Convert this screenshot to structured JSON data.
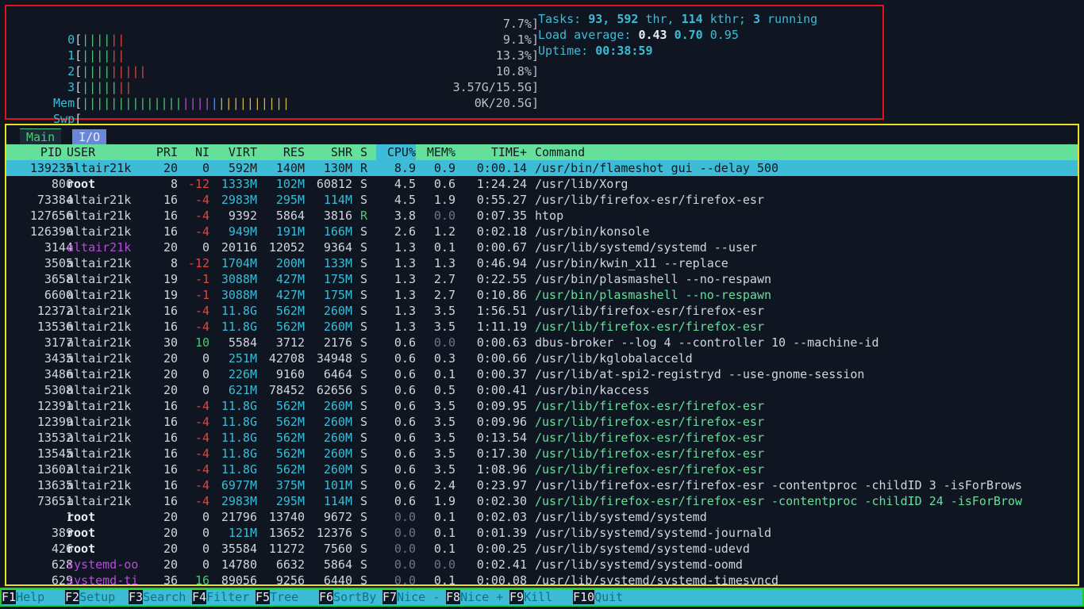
{
  "meters": {
    "cpus": [
      {
        "label": "0",
        "value": "7.7%]"
      },
      {
        "label": "1",
        "value": "9.1%]"
      },
      {
        "label": "2",
        "value": "13.3%]"
      },
      {
        "label": "3",
        "value": "10.8%]"
      }
    ],
    "mem": {
      "label": "Mem",
      "value": "3.57G/15.5G]"
    },
    "swp": {
      "label": "Swp",
      "value": "0K/20.5G]"
    }
  },
  "stats": {
    "tasks_label": "Tasks:",
    "tasks": "93,",
    "threads": "592",
    "thr_label": "thr,",
    "kthreads": "114",
    "kthr_label": "kthr;",
    "running": "3",
    "running_label": "running",
    "load_label": "Load average:",
    "load1": "0.43",
    "load5": "0.70",
    "load15": "0.95",
    "uptime_label": "Uptime:",
    "uptime": "00:38:59"
  },
  "tabs": {
    "main": "Main",
    "io": "I/O"
  },
  "columns": {
    "pid": "PID",
    "user": "USER",
    "pri": "PRI",
    "ni": "NI",
    "virt": "VIRT",
    "res": "RES",
    "shr": "SHR",
    "s": "S",
    "cpu": "CPU%",
    "mem": "MEM%",
    "time": "TIME+",
    "command": "Command"
  },
  "processes": [
    {
      "pid": "139235",
      "user": "altair21k",
      "pri": "20",
      "ni": "0",
      "virt": "592M",
      "res": "140M",
      "shr": "130M",
      "s": "R",
      "cpu": "8.9",
      "mem": "0.9",
      "time": "0:00.14",
      "cmd": "/usr/bin/flameshot gui --delay 500"
    },
    {
      "pid": "800",
      "user": "root",
      "pri": "8",
      "ni": "-12",
      "virt": "1333M",
      "res": "102M",
      "shr": "60812",
      "s": "S",
      "cpu": "4.5",
      "mem": "0.6",
      "time": "1:24.24",
      "cmd": "/usr/lib/Xorg"
    },
    {
      "pid": "73384",
      "user": "altair21k",
      "pri": "16",
      "ni": "-4",
      "virt": "2983M",
      "res": "295M",
      "shr": "114M",
      "s": "S",
      "cpu": "4.5",
      "mem": "1.9",
      "time": "0:55.27",
      "cmd": "/usr/lib/firefox-esr/firefox-esr"
    },
    {
      "pid": "127656",
      "user": "altair21k",
      "pri": "16",
      "ni": "-4",
      "virt": "9392",
      "res": "5864",
      "shr": "3816",
      "s": "R",
      "cpu": "3.8",
      "mem": "0.0",
      "time": "0:07.35",
      "cmd": "htop"
    },
    {
      "pid": "126390",
      "user": "altair21k",
      "pri": "16",
      "ni": "-4",
      "virt": "949M",
      "res": "191M",
      "shr": "166M",
      "s": "S",
      "cpu": "2.6",
      "mem": "1.2",
      "time": "0:02.18",
      "cmd": "/usr/bin/konsole"
    },
    {
      "pid": "3144",
      "user": "altair21k",
      "pri": "20",
      "ni": "0",
      "virt": "20116",
      "res": "12052",
      "shr": "9364",
      "s": "S",
      "cpu": "1.3",
      "mem": "0.1",
      "time": "0:00.67",
      "cmd": "/usr/lib/systemd/systemd --user"
    },
    {
      "pid": "3505",
      "user": "altair21k",
      "pri": "8",
      "ni": "-12",
      "virt": "1704M",
      "res": "200M",
      "shr": "133M",
      "s": "S",
      "cpu": "1.3",
      "mem": "1.3",
      "time": "0:46.94",
      "cmd": "/usr/bin/kwin_x11 --replace"
    },
    {
      "pid": "3658",
      "user": "altair21k",
      "pri": "19",
      "ni": "-1",
      "virt": "3088M",
      "res": "427M",
      "shr": "175M",
      "s": "S",
      "cpu": "1.3",
      "mem": "2.7",
      "time": "0:22.55",
      "cmd": "/usr/bin/plasmashell --no-respawn"
    },
    {
      "pid": "6600",
      "user": "altair21k",
      "pri": "19",
      "ni": "-1",
      "virt": "3088M",
      "res": "427M",
      "shr": "175M",
      "s": "S",
      "cpu": "1.3",
      "mem": "2.7",
      "time": "0:10.86",
      "cmd": "/usr/bin/plasmashell --no-respawn"
    },
    {
      "pid": "12372",
      "user": "altair21k",
      "pri": "16",
      "ni": "-4",
      "virt": "11.8G",
      "res": "562M",
      "shr": "260M",
      "s": "S",
      "cpu": "1.3",
      "mem": "3.5",
      "time": "1:56.51",
      "cmd": "/usr/lib/firefox-esr/firefox-esr"
    },
    {
      "pid": "13536",
      "user": "altair21k",
      "pri": "16",
      "ni": "-4",
      "virt": "11.8G",
      "res": "562M",
      "shr": "260M",
      "s": "S",
      "cpu": "1.3",
      "mem": "3.5",
      "time": "1:11.19",
      "cmd": "/usr/lib/firefox-esr/firefox-esr"
    },
    {
      "pid": "3177",
      "user": "altair21k",
      "pri": "30",
      "ni": "10",
      "virt": "5584",
      "res": "3712",
      "shr": "2176",
      "s": "S",
      "cpu": "0.6",
      "mem": "0.0",
      "time": "0:00.63",
      "cmd": "dbus-broker --log 4 --controller 10 --machine-id"
    },
    {
      "pid": "3435",
      "user": "altair21k",
      "pri": "20",
      "ni": "0",
      "virt": "251M",
      "res": "42708",
      "shr": "34948",
      "s": "S",
      "cpu": "0.6",
      "mem": "0.3",
      "time": "0:00.66",
      "cmd": "/usr/lib/kglobalacceld"
    },
    {
      "pid": "3486",
      "user": "altair21k",
      "pri": "20",
      "ni": "0",
      "virt": "226M",
      "res": "9160",
      "shr": "6464",
      "s": "S",
      "cpu": "0.6",
      "mem": "0.1",
      "time": "0:00.37",
      "cmd": "/usr/lib/at-spi2-registryd --use-gnome-session"
    },
    {
      "pid": "5308",
      "user": "altair21k",
      "pri": "20",
      "ni": "0",
      "virt": "621M",
      "res": "78452",
      "shr": "62656",
      "s": "S",
      "cpu": "0.6",
      "mem": "0.5",
      "time": "0:00.41",
      "cmd": "/usr/bin/kaccess"
    },
    {
      "pid": "12391",
      "user": "altair21k",
      "pri": "16",
      "ni": "-4",
      "virt": "11.8G",
      "res": "562M",
      "shr": "260M",
      "s": "S",
      "cpu": "0.6",
      "mem": "3.5",
      "time": "0:09.95",
      "cmd": "/usr/lib/firefox-esr/firefox-esr"
    },
    {
      "pid": "12399",
      "user": "altair21k",
      "pri": "16",
      "ni": "-4",
      "virt": "11.8G",
      "res": "562M",
      "shr": "260M",
      "s": "S",
      "cpu": "0.6",
      "mem": "3.5",
      "time": "0:09.96",
      "cmd": "/usr/lib/firefox-esr/firefox-esr"
    },
    {
      "pid": "13532",
      "user": "altair21k",
      "pri": "16",
      "ni": "-4",
      "virt": "11.8G",
      "res": "562M",
      "shr": "260M",
      "s": "S",
      "cpu": "0.6",
      "mem": "3.5",
      "time": "0:13.54",
      "cmd": "/usr/lib/firefox-esr/firefox-esr"
    },
    {
      "pid": "13545",
      "user": "altair21k",
      "pri": "16",
      "ni": "-4",
      "virt": "11.8G",
      "res": "562M",
      "shr": "260M",
      "s": "S",
      "cpu": "0.6",
      "mem": "3.5",
      "time": "0:17.30",
      "cmd": "/usr/lib/firefox-esr/firefox-esr"
    },
    {
      "pid": "13603",
      "user": "altair21k",
      "pri": "16",
      "ni": "-4",
      "virt": "11.8G",
      "res": "562M",
      "shr": "260M",
      "s": "S",
      "cpu": "0.6",
      "mem": "3.5",
      "time": "1:08.96",
      "cmd": "/usr/lib/firefox-esr/firefox-esr"
    },
    {
      "pid": "13635",
      "user": "altair21k",
      "pri": "16",
      "ni": "-4",
      "virt": "6977M",
      "res": "375M",
      "shr": "101M",
      "s": "S",
      "cpu": "0.6",
      "mem": "2.4",
      "time": "0:23.97",
      "cmd": "/usr/lib/firefox-esr/firefox-esr -contentproc -childID 3 -isForBrows"
    },
    {
      "pid": "73651",
      "user": "altair21k",
      "pri": "16",
      "ni": "-4",
      "virt": "2983M",
      "res": "295M",
      "shr": "114M",
      "s": "S",
      "cpu": "0.6",
      "mem": "1.9",
      "time": "0:02.30",
      "cmd": "/usr/lib/firefox-esr/firefox-esr -contentproc -childID 24 -isForBrow"
    },
    {
      "pid": "1",
      "user": "root",
      "pri": "20",
      "ni": "0",
      "virt": "21796",
      "res": "13740",
      "shr": "9672",
      "s": "S",
      "cpu": "0.0",
      "mem": "0.1",
      "time": "0:02.03",
      "cmd": "/usr/lib/systemd/systemd"
    },
    {
      "pid": "389",
      "user": "root",
      "pri": "20",
      "ni": "0",
      "virt": "121M",
      "res": "13652",
      "shr": "12376",
      "s": "S",
      "cpu": "0.0",
      "mem": "0.1",
      "time": "0:01.39",
      "cmd": "/usr/lib/systemd/systemd-journald"
    },
    {
      "pid": "426",
      "user": "root",
      "pri": "20",
      "ni": "0",
      "virt": "35584",
      "res": "11272",
      "shr": "7560",
      "s": "S",
      "cpu": "0.0",
      "mem": "0.1",
      "time": "0:00.25",
      "cmd": "/usr/lib/systemd/systemd-udevd"
    },
    {
      "pid": "628",
      "user": "systemd-oo",
      "pri": "20",
      "ni": "0",
      "virt": "14780",
      "res": "6632",
      "shr": "5864",
      "s": "S",
      "cpu": "0.0",
      "mem": "0.0",
      "time": "0:02.41",
      "cmd": "/usr/lib/systemd/systemd-oomd"
    },
    {
      "pid": "629",
      "user": "systemd-ti",
      "pri": "36",
      "ni": "16",
      "virt": "89056",
      "res": "9256",
      "shr": "6440",
      "s": "S",
      "cpu": "0.0",
      "mem": "0.1",
      "time": "0:00.08",
      "cmd": "/usr/lib/systemd/systemd-timesyncd"
    }
  ],
  "function_keys": [
    {
      "key": "F1",
      "label": "Help"
    },
    {
      "key": "F2",
      "label": "Setup"
    },
    {
      "key": "F3",
      "label": "Search"
    },
    {
      "key": "F4",
      "label": "Filter"
    },
    {
      "key": "F5",
      "label": "Tree"
    },
    {
      "key": "F6",
      "label": "SortBy"
    },
    {
      "key": "F7",
      "label": "Nice -"
    },
    {
      "key": "F8",
      "label": "Nice +"
    },
    {
      "key": "F9",
      "label": "Kill"
    },
    {
      "key": "F10",
      "label": "Quit"
    }
  ]
}
